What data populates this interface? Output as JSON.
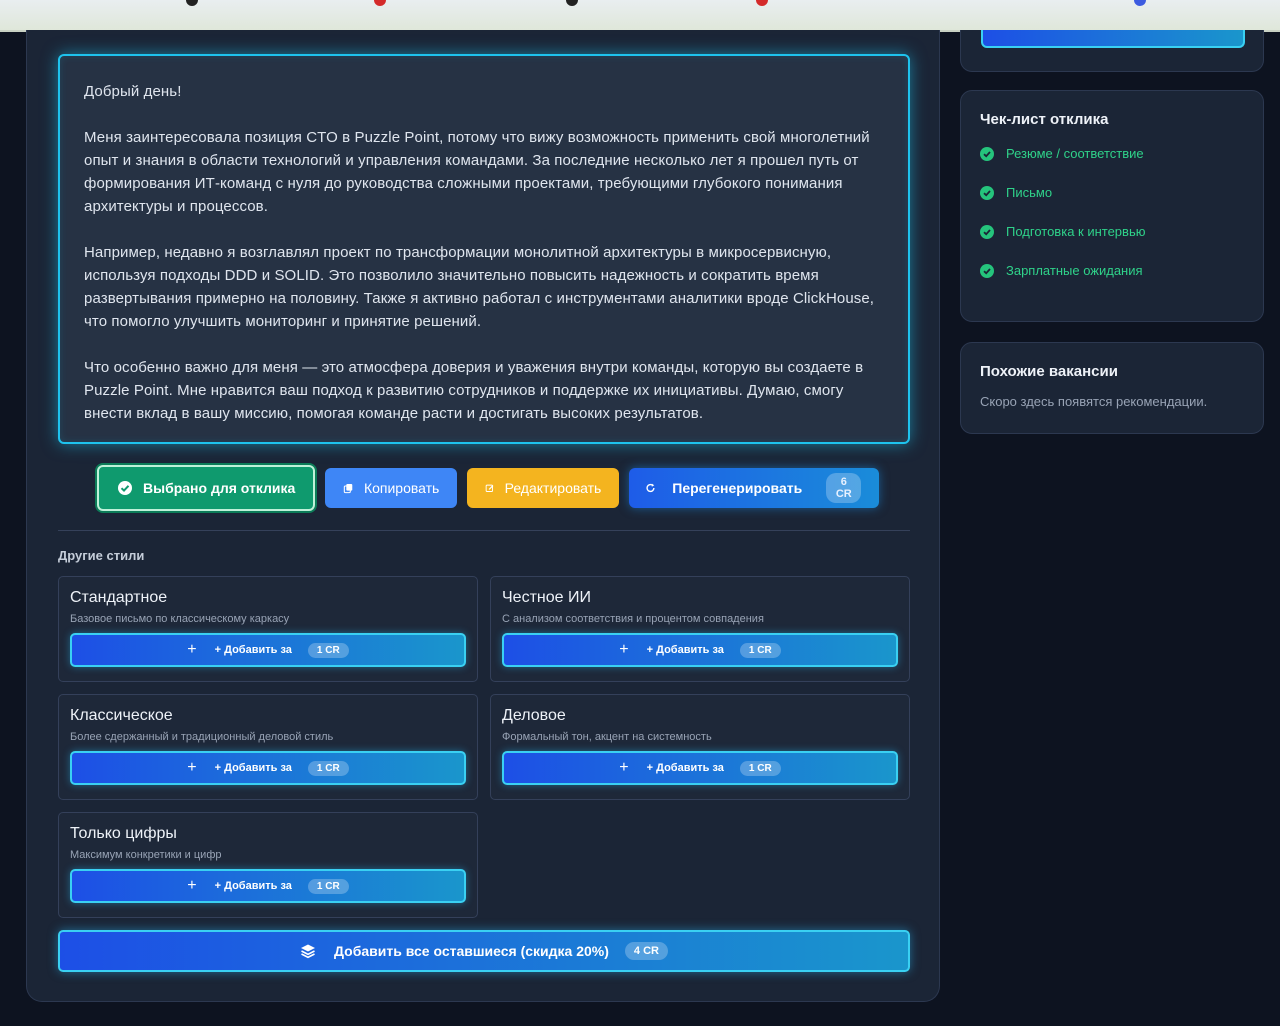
{
  "letter": {
    "paragraphs": [
      "Добрый день!",
      "Меня заинтересовала позиция CTO в Puzzle Point, потому что вижу возможность применить свой многолетний опыт и знания в области технологий и управления командами. За последние несколько лет я прошел путь от формирования ИТ-команд с нуля до руководства сложными проектами, требующими глубокого понимания архитектуры и процессов.",
      "Например, недавно я возглавлял проект по трансформации монолитной архитектуры в микросервисную, используя подходы DDD и SOLID. Это позволило значительно повысить надежность и сократить время развертывания примерно на половину. Также я активно работал с инструментами аналитики вроде ClickHouse, что помогло улучшить мониторинг и принятие решений.",
      "Что особенно важно для меня — это атмосфера доверия и уважения внутри команды, которую вы создаете в Puzzle Point. Мне нравится ваш подход к развитию сотрудников и поддержке их инициативы. Думаю, смогу внести вклад в вашу миссию, помогая команде расти и достигать высоких результатов."
    ]
  },
  "actions": {
    "selected_label": "Выбрано для отклика",
    "copy_label": "Копировать",
    "edit_label": "Редактировать",
    "regen_label": "Перегенерировать",
    "regen_cost": "6 CR"
  },
  "other_styles": {
    "title": "Другие стили",
    "add_prefix": "+ Добавить за",
    "items": [
      {
        "title": "Стандартное",
        "desc": "Базовое письмо по классическому каркасу",
        "cost": "1 CR"
      },
      {
        "title": "Честное ИИ",
        "desc": "С анализом соответствия и процентом совпадения",
        "cost": "1 CR"
      },
      {
        "title": "Классическое",
        "desc": "Более сдержанный и традиционный деловой стиль",
        "cost": "1 CR"
      },
      {
        "title": "Деловое",
        "desc": "Формальный тон, акцент на системность",
        "cost": "1 CR"
      },
      {
        "title": "Только цифры",
        "desc": "Максимум конкретики и цифр",
        "cost": "1 CR"
      }
    ],
    "add_all_label": "Добавить все оставшиеся (скидка 20%)",
    "add_all_cost": "4 CR"
  },
  "checklist": {
    "title": "Чек-лист отклика",
    "items": [
      "Резюме / соответствие",
      "Письмо",
      "Подготовка к интервью",
      "Зарплатные ожидания"
    ],
    "color": "#2fd28a"
  },
  "similar": {
    "title": "Похожие вакансии",
    "note": "Скоро здесь появятся рекомендации."
  },
  "colors": {
    "accent": "#1ec3ee",
    "selected": "#0f9a6e",
    "copy": "#3e86f6",
    "edit": "#f4b41f"
  }
}
